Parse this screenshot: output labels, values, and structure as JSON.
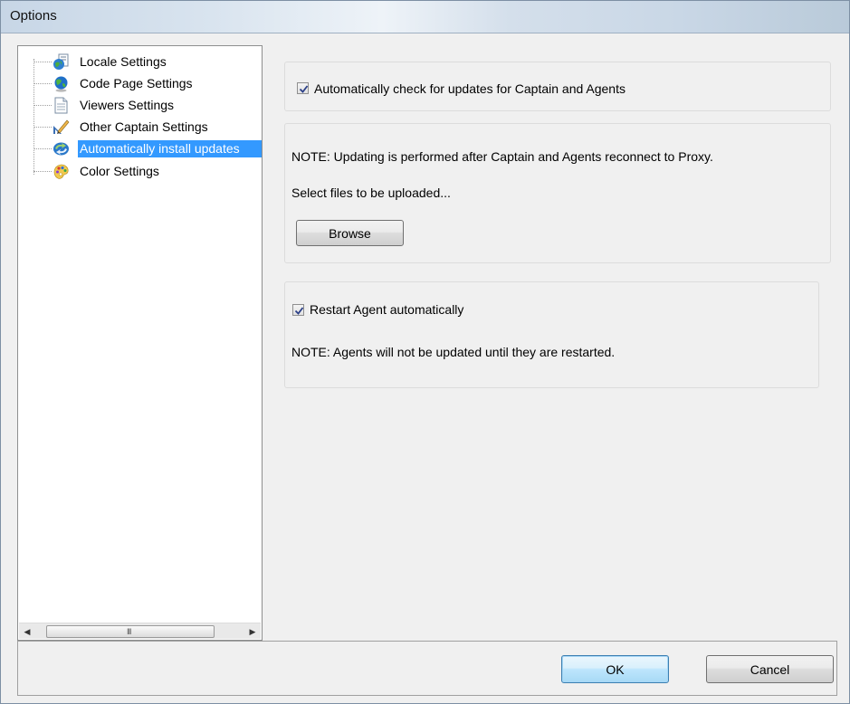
{
  "window": {
    "title": "Options"
  },
  "tree": {
    "items": [
      {
        "label": "Locale Settings",
        "icon": "globe-document-icon",
        "selected": false
      },
      {
        "label": "Code Page Settings",
        "icon": "globe-icon",
        "selected": false
      },
      {
        "label": "Viewers Settings",
        "icon": "document-icon",
        "selected": false
      },
      {
        "label": "Other Captain Settings",
        "icon": "ruler-pencil-icon",
        "selected": false
      },
      {
        "label": "Automatically install updates",
        "icon": "update-arrows-icon",
        "selected": true
      },
      {
        "label": "Color Settings",
        "icon": "palette-icon",
        "selected": false
      }
    ],
    "scroll_grip": "III"
  },
  "updates": {
    "auto_check": {
      "label": "Automatically check for updates for Captain and Agents",
      "checked": true
    },
    "note_reconnect": "NOTE: Updating is performed after Captain and Agents reconnect to Proxy.",
    "select_files": "Select files to be uploaded...",
    "browse_label": "Browse",
    "restart_agent": {
      "label": "Restart Agent automatically",
      "checked": true
    },
    "note_restart": "NOTE: Agents will not be updated until they are restarted."
  },
  "buttons": {
    "ok_label": "OK",
    "cancel_label": "Cancel"
  },
  "colors": {
    "selection": "#3399ff",
    "default_button_border": "#3c7fb1"
  }
}
